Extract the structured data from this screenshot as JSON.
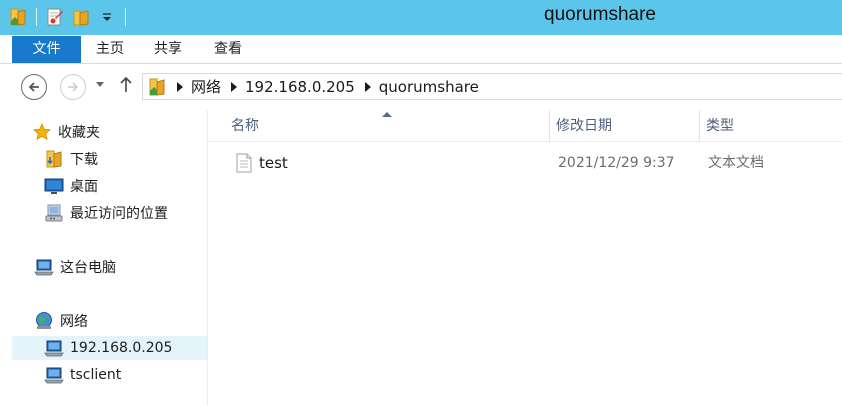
{
  "window": {
    "title": "quorumshare"
  },
  "quick_access_toolbar": {
    "icons": [
      "folder-icon",
      "properties-icon",
      "new-folder-icon",
      "customize-dropdown-icon"
    ]
  },
  "ribbon": {
    "tabs": [
      {
        "label": "文件",
        "active": true
      },
      {
        "label": "主页"
      },
      {
        "label": "共享"
      },
      {
        "label": "查看"
      }
    ]
  },
  "address_bar": {
    "breadcrumbs": [
      "网络",
      "192.168.0.205",
      "quorumshare"
    ]
  },
  "nav_pane": {
    "favorites": {
      "label": "收藏夹",
      "items": [
        {
          "label": "下载",
          "icon": "download-folder-icon"
        },
        {
          "label": "桌面",
          "icon": "desktop-icon"
        },
        {
          "label": "最近访问的位置",
          "icon": "recent-places-icon"
        }
      ]
    },
    "this_pc": {
      "label": "这台电脑"
    },
    "network": {
      "label": "网络",
      "items": [
        {
          "label": "192.168.0.205",
          "selected": true
        },
        {
          "label": "tsclient"
        }
      ]
    }
  },
  "file_list": {
    "columns": {
      "name": "名称",
      "date": "修改日期",
      "type": "类型"
    },
    "sort_column": "name",
    "rows": [
      {
        "name": "test",
        "date": "2021/12/29 9:37",
        "type": "文本文档"
      }
    ]
  },
  "colors": {
    "titlebar": "#5cc6ea",
    "file_tab": "#1979ca",
    "column_header_text": "#4c607a",
    "selection": "#e5f3fb"
  }
}
